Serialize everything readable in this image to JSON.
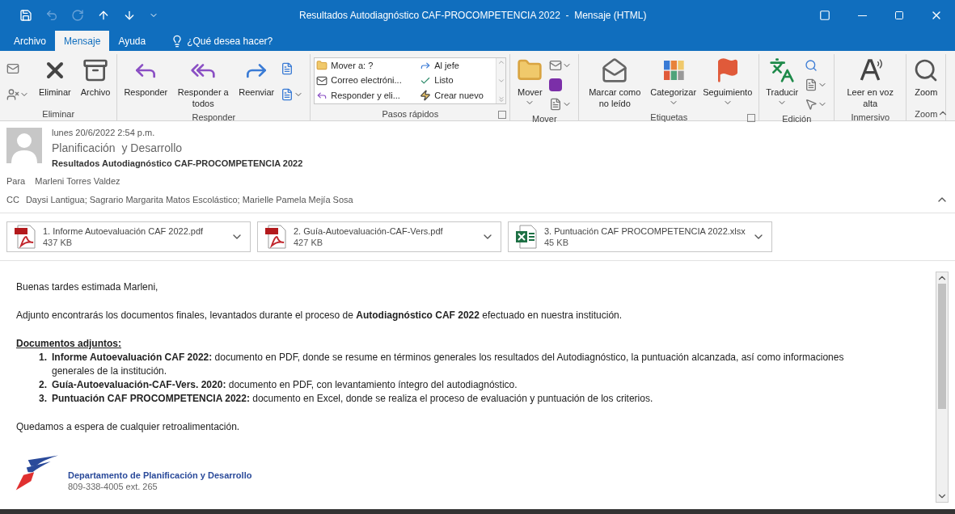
{
  "window": {
    "title": "Resultados Autodiagnóstico CAF-PROCOMPETENCIA 2022  -  Mensaje (HTML)"
  },
  "tabs": [
    {
      "label": "Archivo",
      "selected": false
    },
    {
      "label": "Mensaje",
      "selected": true
    },
    {
      "label": "Ayuda",
      "selected": false
    }
  ],
  "tell_me": {
    "placeholder": "¿Qué desea hacer?"
  },
  "ribbon": {
    "groups": [
      {
        "label": "Eliminar",
        "kind": "delete",
        "launcher": false,
        "buttons": [
          {
            "label": "Eliminar",
            "dropdown": false
          },
          {
            "label": "Archivo",
            "dropdown": false
          }
        ]
      },
      {
        "label": "Responder",
        "kind": "respond",
        "launcher": false,
        "buttons": [
          {
            "label": "Responder",
            "dropdown": false
          },
          {
            "label": "Responder a todos",
            "dropdown": false
          },
          {
            "label": "Reenviar",
            "dropdown": false
          }
        ]
      },
      {
        "label": "Pasos rápidos",
        "kind": "quicksteps",
        "launcher": true,
        "steps": [
          "Mover a: ?",
          "Correo electróni...",
          "Responder y eli...",
          "Al jefe",
          "Listo",
          "Crear nuevo"
        ]
      },
      {
        "label": "Mover",
        "kind": "move",
        "launcher": false,
        "buttons": [
          {
            "label": "Mover",
            "dropdown": true
          }
        ]
      },
      {
        "label": "Etiquetas",
        "kind": "tags",
        "launcher": true,
        "buttons": [
          {
            "label": "Marcar como no leído",
            "dropdown": false
          },
          {
            "label": "Categorizar",
            "dropdown": true
          },
          {
            "label": "Seguimiento",
            "dropdown": true
          }
        ]
      },
      {
        "label": "Edición",
        "kind": "edit",
        "launcher": false,
        "buttons": [
          {
            "label": "Traducir",
            "dropdown": true
          }
        ]
      },
      {
        "label": "Inmersivo",
        "kind": "immersive",
        "launcher": false,
        "buttons": [
          {
            "label": "Leer en voz alta",
            "dropdown": false
          }
        ]
      },
      {
        "label": "Zoom",
        "kind": "zoom",
        "launcher": false,
        "buttons": [
          {
            "label": "Zoom",
            "dropdown": false
          }
        ]
      }
    ]
  },
  "message": {
    "date": "lunes 20/6/2022 2:54 p.m.",
    "sender": "Planificación  y Desarrollo",
    "subject": "Resultados Autodiagnóstico CAF-PROCOMPETENCIA 2022",
    "to_label": "Para",
    "to": "Marleni Torres Valdez",
    "cc_label": "CC",
    "cc": "Daysi Lantigua; Sagrario Margarita Matos Escolástico; Marielle Pamela Mejía Sosa"
  },
  "attachments": [
    {
      "name": "1. Informe Autoevaluación CAF 2022.pdf",
      "size": "437 KB",
      "kind": "pdf"
    },
    {
      "name": "2. Guía-Autoevaluación-CAF-Vers.pdf",
      "size": "427 KB",
      "kind": "pdf"
    },
    {
      "name": "3. Puntuación CAF PROCOMPETENCIA 2022.xlsx",
      "size": "45 KB",
      "kind": "xlsx"
    }
  ],
  "body": {
    "greeting": "Buenas tardes estimada Marleni,",
    "intro": "Adjunto encontrarás los documentos finales, levantados durante el proceso de **Autodiagnóstico CAF 2022** efectuado en nuestra institución.",
    "heading": "Documentos adjuntos:",
    "items": [
      {
        "number": "1.",
        "text": "**Informe Autoevaluación CAF 2022:** documento en PDF, donde se resume en términos generales los resultados del Autodiagnóstico, la puntuación alcanzada, así como informaciones generales de la institución."
      },
      {
        "number": "2.",
        "text": "**Guía-Autoevaluación-CAF-Vers. 2020:** documento en PDF, con levantamiento íntegro del autodiagnóstico."
      },
      {
        "number": "3.",
        "text": "**Puntuación CAF PROCOMPETENCIA 2022:** documento en Excel, donde se realiza el proceso de evaluación y puntuación de los criterios."
      }
    ],
    "closing": "Quedamos a espera de cualquier retroalimentación."
  },
  "signature": {
    "department": "Departamento de Planificación y Desarrollo",
    "phone": "809-338-4005 ext. 265"
  }
}
